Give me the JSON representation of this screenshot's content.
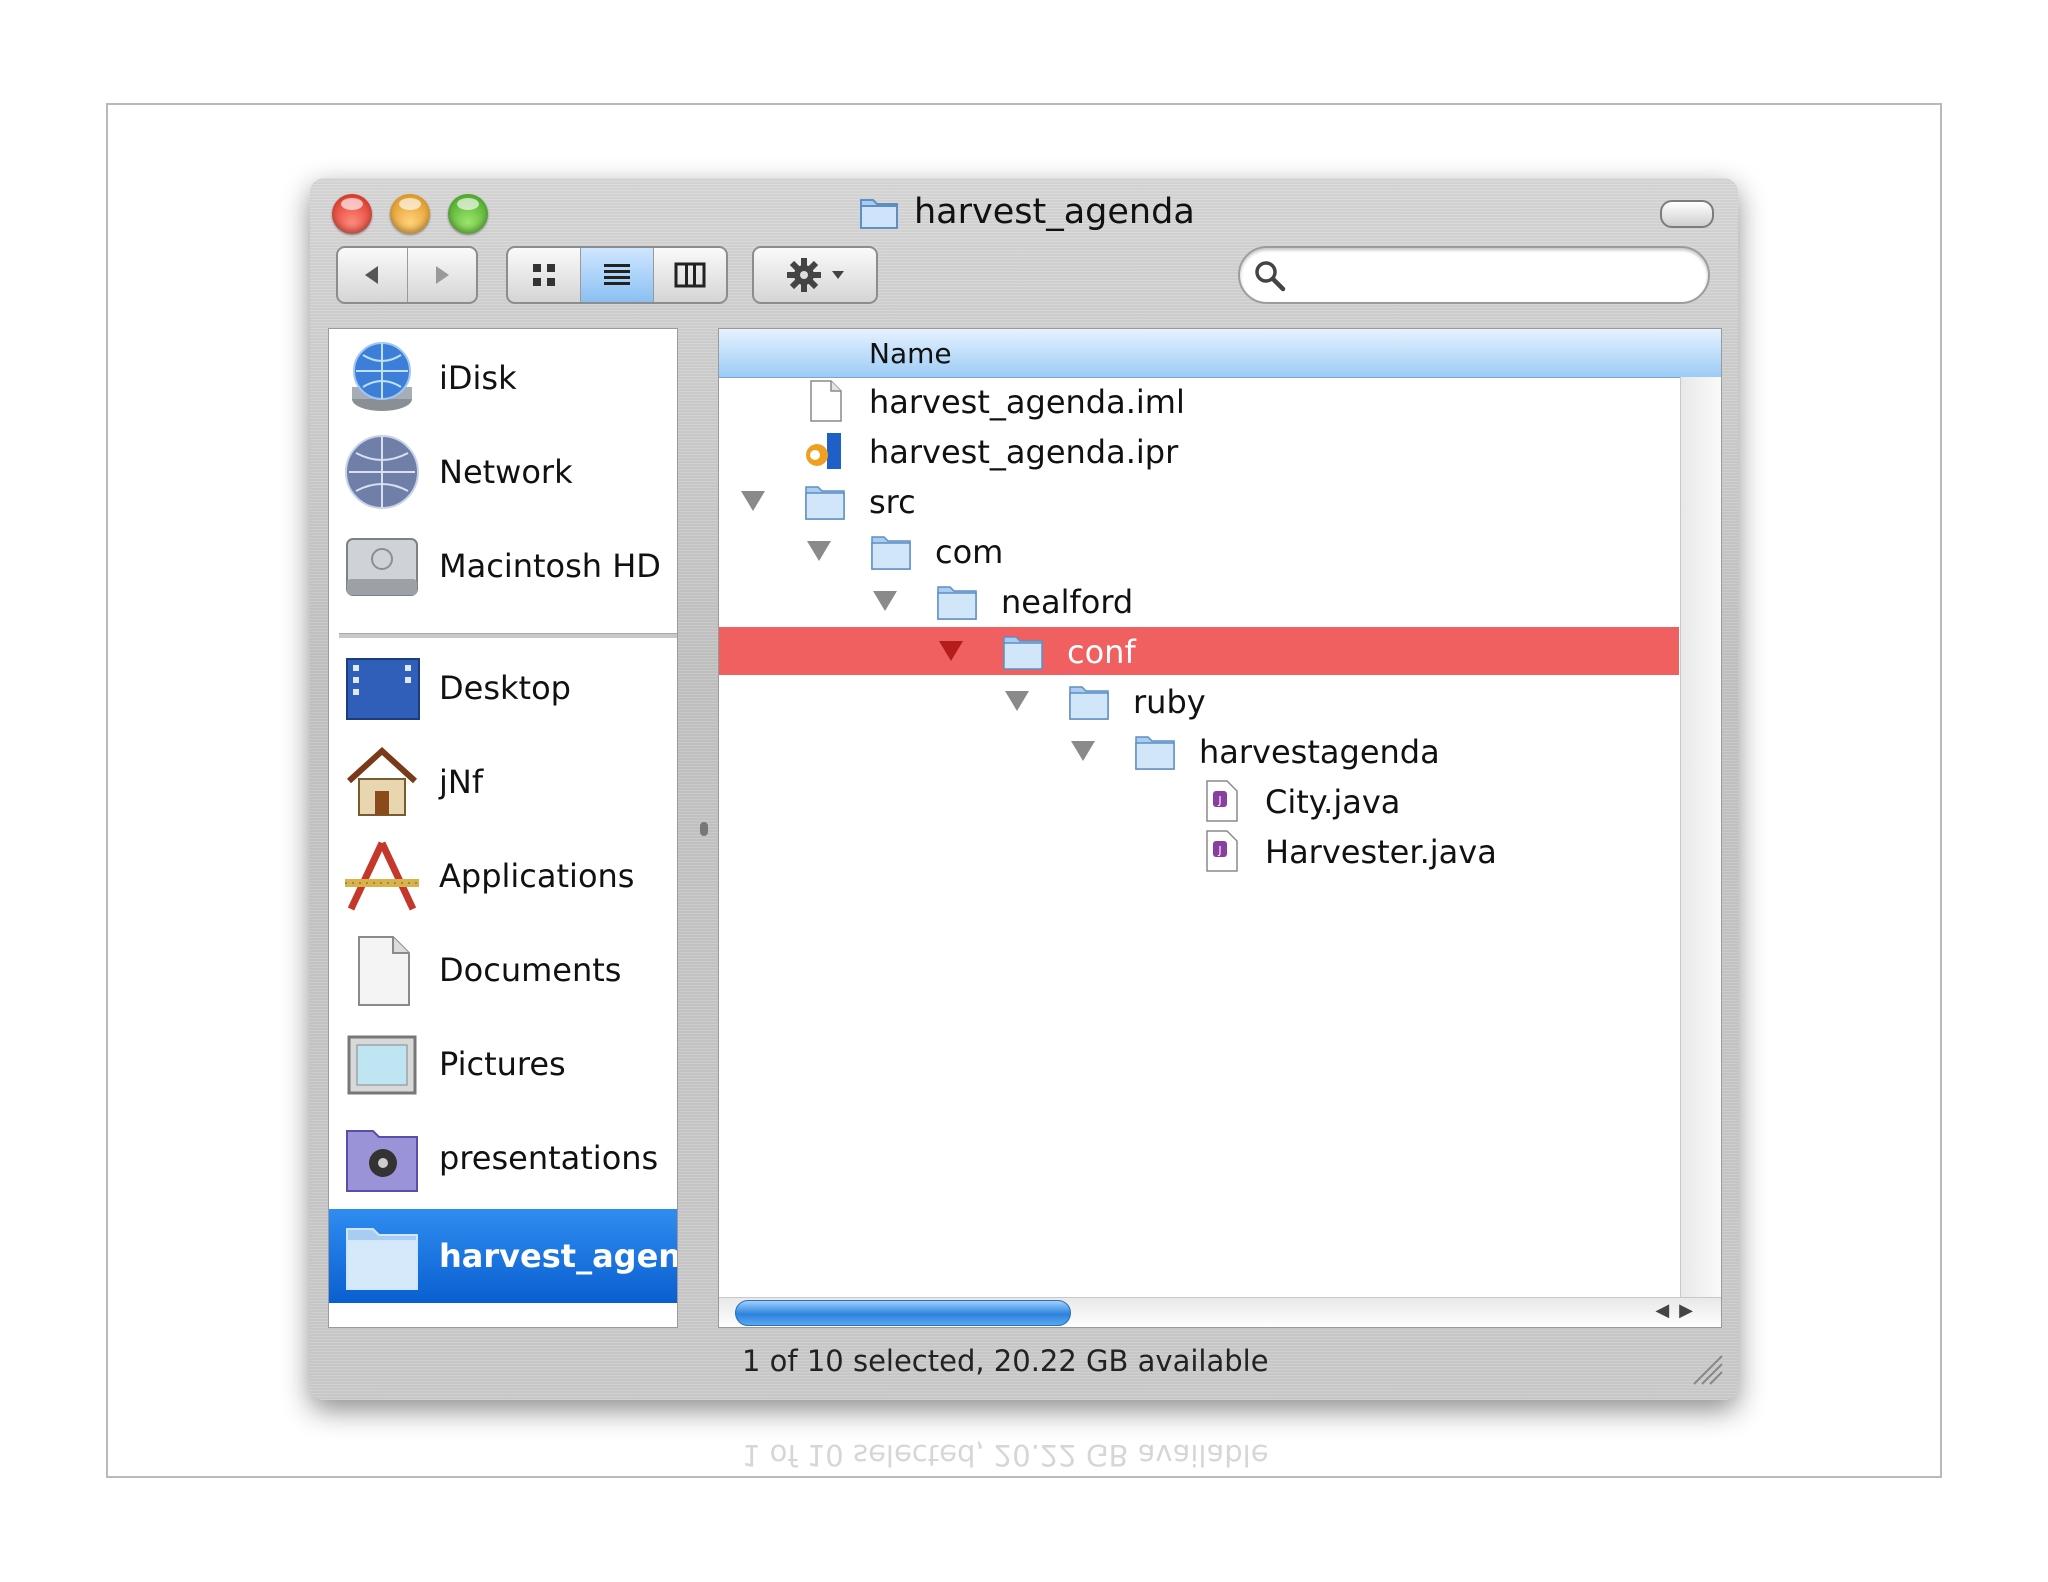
{
  "window": {
    "title": "harvest_agenda"
  },
  "toolbar": {
    "back_icon": "back-arrow-icon",
    "forward_icon": "forward-arrow-icon",
    "views": [
      "icon-view",
      "list-view",
      "column-view"
    ],
    "active_view": "list-view",
    "action_icon": "gear-icon",
    "search_placeholder": ""
  },
  "sidebar": {
    "devices": [
      {
        "label": "iDisk",
        "icon": "idisk-icon"
      },
      {
        "label": "Network",
        "icon": "network-globe-icon"
      },
      {
        "label": "Macintosh HD",
        "icon": "hard-drive-icon"
      }
    ],
    "places": [
      {
        "label": "Desktop",
        "icon": "desktop-icon"
      },
      {
        "label": "jNf",
        "icon": "home-icon"
      },
      {
        "label": "Applications",
        "icon": "applications-icon"
      },
      {
        "label": "Documents",
        "icon": "documents-icon"
      },
      {
        "label": "Pictures",
        "icon": "pictures-icon"
      },
      {
        "label": "presentations",
        "icon": "presentations-folder-icon"
      },
      {
        "label": "harvest_agen...",
        "icon": "folder-icon",
        "selected": true
      }
    ]
  },
  "list": {
    "column_header": "Name",
    "rows": [
      {
        "name": "harvest_agenda.iml",
        "icon": "document-icon",
        "depth": 0,
        "disclosure": false
      },
      {
        "name": "harvest_agenda.ipr",
        "icon": "intellij-icon",
        "depth": 0,
        "disclosure": false
      },
      {
        "name": "src",
        "icon": "folder-icon",
        "depth": 0,
        "disclosure": true
      },
      {
        "name": "com",
        "icon": "folder-icon",
        "depth": 1,
        "disclosure": true
      },
      {
        "name": "nealford",
        "icon": "folder-icon",
        "depth": 2,
        "disclosure": true
      },
      {
        "name": "conf",
        "icon": "folder-icon",
        "depth": 3,
        "disclosure": true,
        "selected": true
      },
      {
        "name": "ruby",
        "icon": "folder-icon",
        "depth": 4,
        "disclosure": true
      },
      {
        "name": "harvestagenda",
        "icon": "folder-icon",
        "depth": 5,
        "disclosure": true
      },
      {
        "name": "City.java",
        "icon": "java-file-icon",
        "depth": 6,
        "disclosure": false
      },
      {
        "name": "Harvester.java",
        "icon": "java-file-icon",
        "depth": 6,
        "disclosure": false
      }
    ]
  },
  "status": {
    "text": "1 of 10 selected, 20.22 GB available"
  },
  "colors": {
    "selection_red": "#f06060",
    "sidebar_selection_blue": "#0a5fd0",
    "header_blue": "#9ccbf5"
  }
}
